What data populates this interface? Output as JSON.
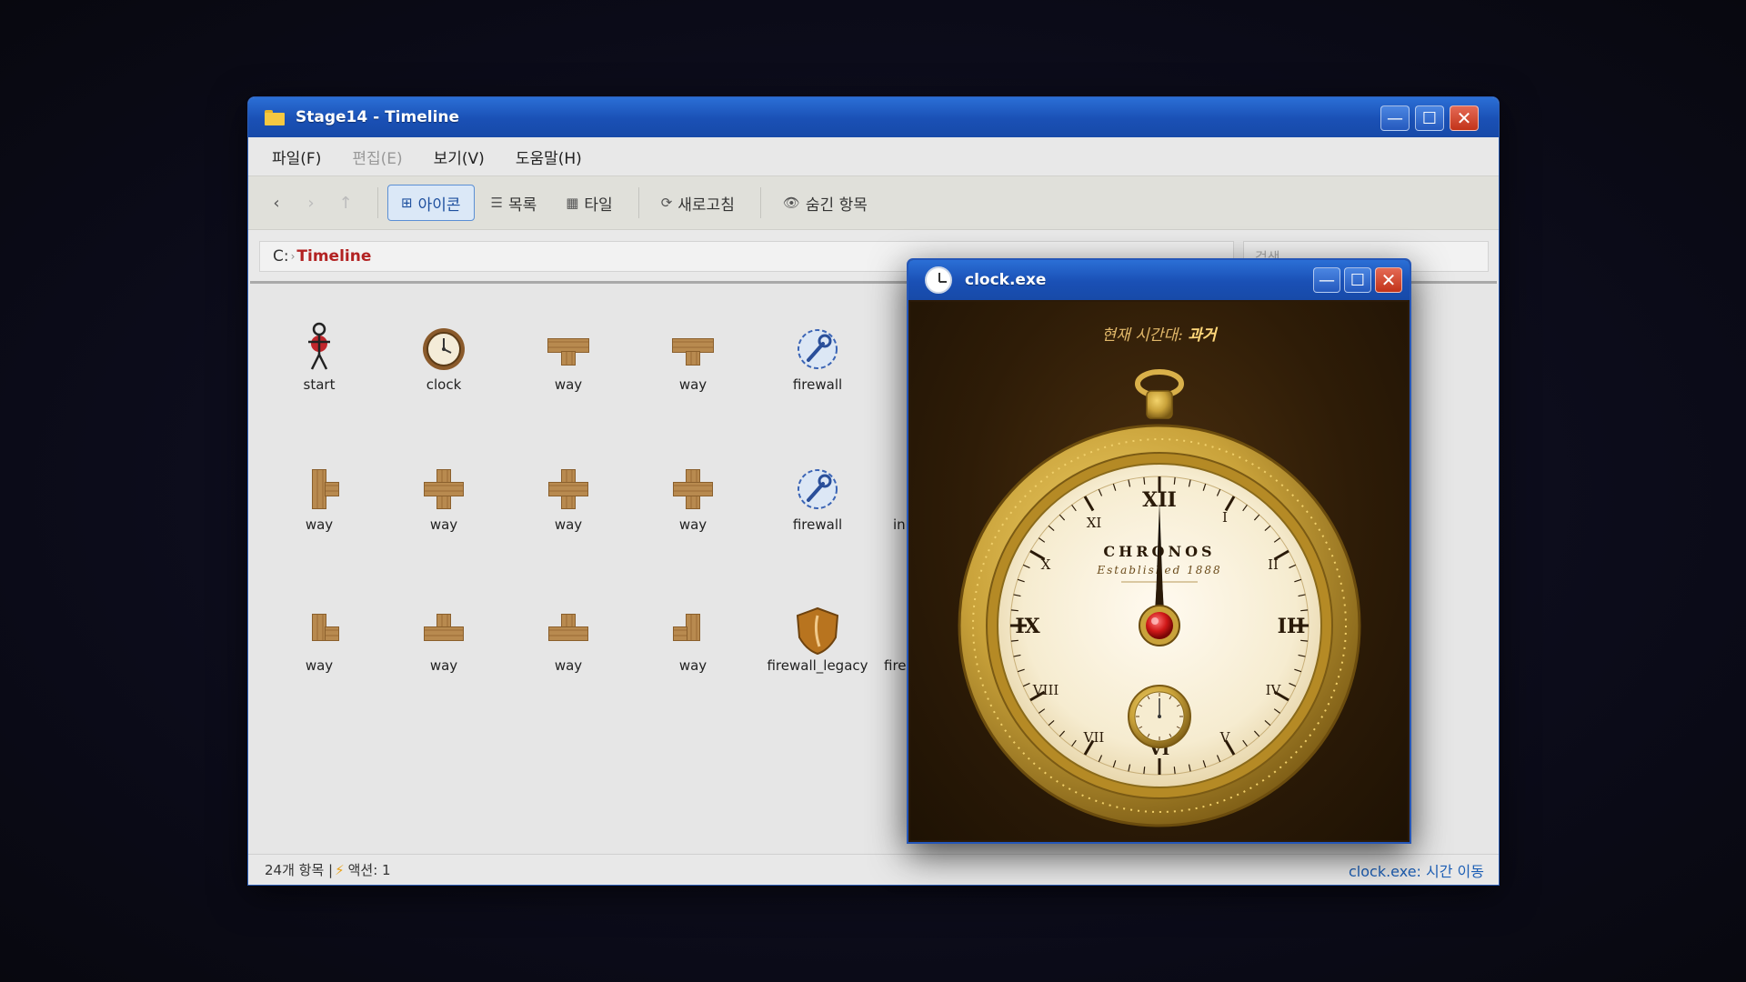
{
  "explorer": {
    "title": "Stage14 - Timeline",
    "menu": [
      "파일(F)",
      "편집(E)",
      "보기(V)",
      "도움말(H)"
    ],
    "nav": {
      "back": "‹",
      "forward": "›",
      "up": "↑"
    },
    "toolbar": {
      "icon_view": "아이콘",
      "list_view": "목록",
      "tile_view": "타일",
      "refresh": "새로고침",
      "hidden_items": "숨긴 항목"
    },
    "address": {
      "drive": "C:",
      "separator": "›",
      "folder": "Timeline"
    },
    "search_placeholder": "검색",
    "files": [
      {
        "label": "start",
        "icon": "stick-figure-icon"
      },
      {
        "label": "clock",
        "icon": "pocket-clock-icon"
      },
      {
        "label": "way",
        "icon": "wood-tee-down-icon"
      },
      {
        "label": "way",
        "icon": "wood-tee-down-icon"
      },
      {
        "label": "firewall",
        "icon": "wrench-badge-icon"
      },
      {
        "label": "way",
        "icon": "wood-tee-right-icon"
      },
      {
        "label": "way",
        "icon": "wood-cross-icon"
      },
      {
        "label": "way",
        "icon": "wood-cross-icon"
      },
      {
        "label": "way",
        "icon": "wood-cross-icon"
      },
      {
        "label": "firewall",
        "icon": "wrench-badge-icon"
      },
      {
        "label": "way",
        "icon": "wood-corner-icon"
      },
      {
        "label": "way",
        "icon": "wood-tee-up-icon"
      },
      {
        "label": "way",
        "icon": "wood-tee-up-icon"
      },
      {
        "label": "way",
        "icon": "wood-corner-left-icon"
      },
      {
        "label": "firewall_legacy",
        "icon": "shield-icon"
      }
    ],
    "partial_labels": [
      "in",
      "fire"
    ],
    "status": {
      "items": "24개 항목 |",
      "actions": "액션: 1",
      "right": "clock.exe: 시간 이동"
    }
  },
  "clock_window": {
    "title": "clock.exe",
    "era_label": "현재 시간대:",
    "era_value": "과거",
    "brand": "CHRONOS",
    "established": "Established 1888",
    "numerals": [
      "XII",
      "I",
      "II",
      "III",
      "IV",
      "V",
      "VI",
      "VII",
      "VIII",
      "IX",
      "X",
      "XI"
    ],
    "time": {
      "hour": 12,
      "minute": 0
    }
  },
  "colors": {
    "titlebar": "#1a50b5",
    "address_folder": "#b22222",
    "status_right": "#1d5fb5",
    "gold": "#c9a23a",
    "dial": "#f6ecd0"
  }
}
